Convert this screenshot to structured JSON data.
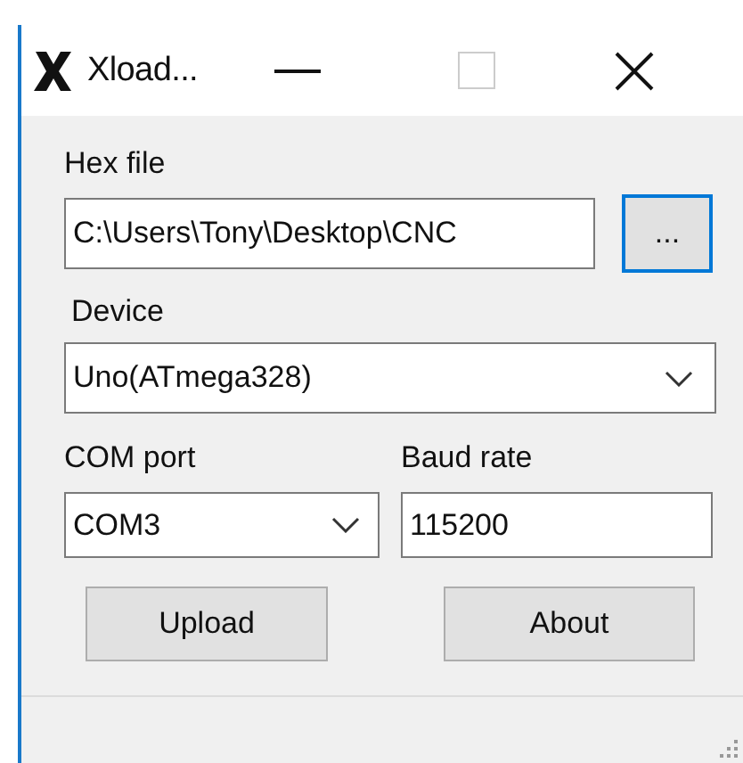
{
  "window": {
    "title": "Xload..."
  },
  "hex_file": {
    "label": "Hex file",
    "value": "C:\\Users\\Tony\\Desktop\\CNC",
    "browse_button": "...",
    "browse_focused": true
  },
  "device": {
    "label": "Device",
    "value": "Uno(ATmega328)"
  },
  "com_port": {
    "label": "COM port",
    "value": "COM3"
  },
  "baud_rate": {
    "label": "Baud rate",
    "value": "115200"
  },
  "buttons": [
    "Upload",
    "About"
  ]
}
